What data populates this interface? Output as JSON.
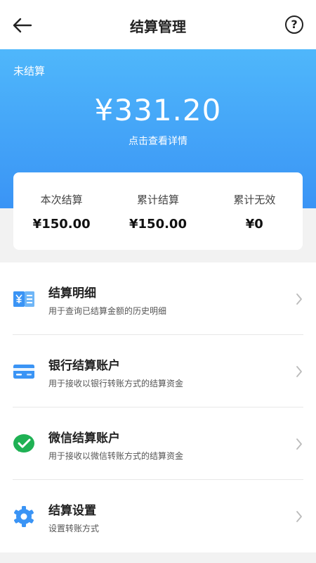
{
  "header": {
    "title": "结算管理",
    "help_label": "?"
  },
  "hero": {
    "label": "未结算",
    "amount": "¥331.20",
    "link": "点击查看详情"
  },
  "summary": [
    {
      "label": "本次结算",
      "value": "¥150.00"
    },
    {
      "label": "累计结算",
      "value": "¥150.00"
    },
    {
      "label": "累计无效",
      "value": "¥0"
    }
  ],
  "menu": [
    {
      "title": "结算明细",
      "desc": "用于查询已结算金额的历史明细",
      "icon": "receipt-yen-icon"
    },
    {
      "title": "银行结算账户",
      "desc": "用于接收以银行转账方式的结算资金",
      "icon": "bank-card-icon"
    },
    {
      "title": "微信结算账户",
      "desc": "用于接收以微信转账方式的结算资金",
      "icon": "wechat-icon"
    },
    {
      "title": "结算设置",
      "desc": "设置转账方式",
      "icon": "gear-icon"
    }
  ],
  "colors": {
    "accent": "#3a94f5",
    "accent_light": "#4fb7fb",
    "wechat": "#1fb154",
    "background": "#f2f2f2"
  }
}
